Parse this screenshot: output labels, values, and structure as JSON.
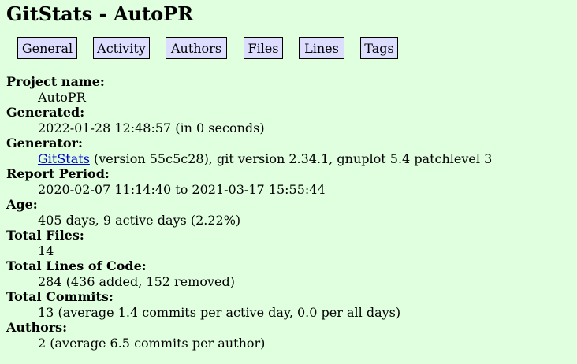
{
  "title": "GitStats - AutoPR",
  "tabs": [
    {
      "label": "General"
    },
    {
      "label": "Activity"
    },
    {
      "label": "Authors"
    },
    {
      "label": "Files"
    },
    {
      "label": "Lines"
    },
    {
      "label": "Tags"
    }
  ],
  "stats": {
    "project_name": {
      "label": "Project name:",
      "value": "AutoPR"
    },
    "generated": {
      "label": "Generated:",
      "value": "2022-01-28 12:48:57 (in 0 seconds)"
    },
    "generator": {
      "label": "Generator:",
      "link_text": "GitStats",
      "value_rest": " (version 55c5c28), git version 2.34.1, gnuplot 5.4 patchlevel 3"
    },
    "report_period": {
      "label": "Report Period:",
      "value": "2020-02-07 11:14:40 to 2021-03-17 15:55:44"
    },
    "age": {
      "label": "Age:",
      "value": "405 days, 9 active days (2.22%)"
    },
    "total_files": {
      "label": "Total Files:",
      "value": "14"
    },
    "total_lines": {
      "label": "Total Lines of Code:",
      "value": "284 (436 added, 152 removed)"
    },
    "total_commits": {
      "label": "Total Commits:",
      "value": "13 (average 1.4 commits per active day, 0.0 per all days)"
    },
    "authors": {
      "label": "Authors:",
      "value": "2 (average 6.5 commits per author)"
    }
  },
  "colors": {
    "background": "#dfffdf",
    "tab_background": "#ddddff",
    "link": "#0000cc"
  }
}
